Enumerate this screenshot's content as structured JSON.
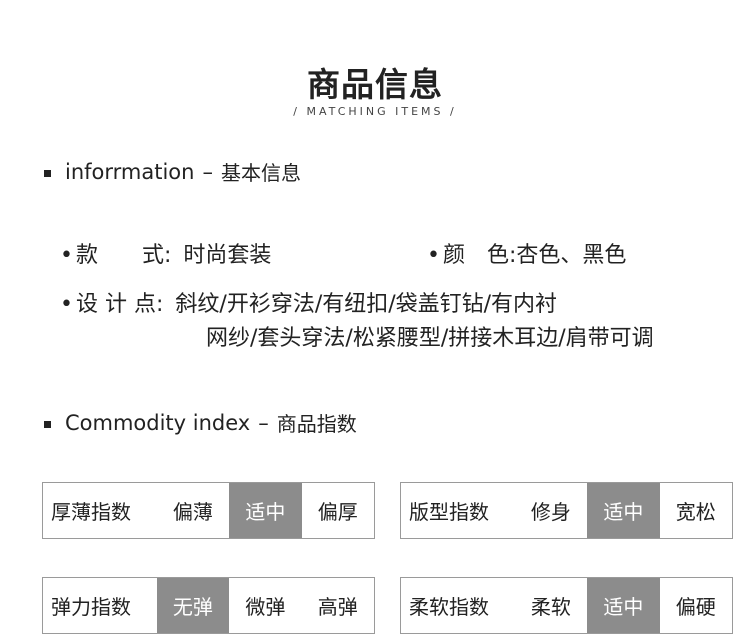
{
  "header": {
    "title": "商品信息",
    "subtitle": "/ MATCHING ITEMS /"
  },
  "section_info": {
    "title_en": "inforrmation",
    "dash": "–",
    "title_zh": "基本信息"
  },
  "specs": {
    "style_label": "款　　式:",
    "style_value": "时尚套装",
    "color_label": "颜　色:",
    "color_value": "杏色、黑色",
    "design_label": "设 计 点:",
    "design_line1": "斜纹/开衫穿法/有纽扣/袋盖钉钻/有内衬",
    "design_line2": "网纱/套头穿法/松紧腰型/拼接木耳边/肩带可调"
  },
  "section_index": {
    "title_en": "Commodity index",
    "dash": "–",
    "title_zh": "商品指数"
  },
  "indices": [
    {
      "label": "厚薄指数",
      "options": [
        "偏薄",
        "适中",
        "偏厚"
      ],
      "selected": 1
    },
    {
      "label": "版型指数",
      "options": [
        "修身",
        "适中",
        "宽松"
      ],
      "selected": 1
    },
    {
      "label": "弹力指数",
      "options": [
        "无弹",
        "微弹",
        "高弹"
      ],
      "selected": 0
    },
    {
      "label": "柔软指数",
      "options": [
        "柔软",
        "适中",
        "偏硬"
      ],
      "selected": 1
    }
  ],
  "colors": {
    "selected_bg": "#8c8c8c",
    "border": "#9a9a9a",
    "text": "#222222"
  }
}
